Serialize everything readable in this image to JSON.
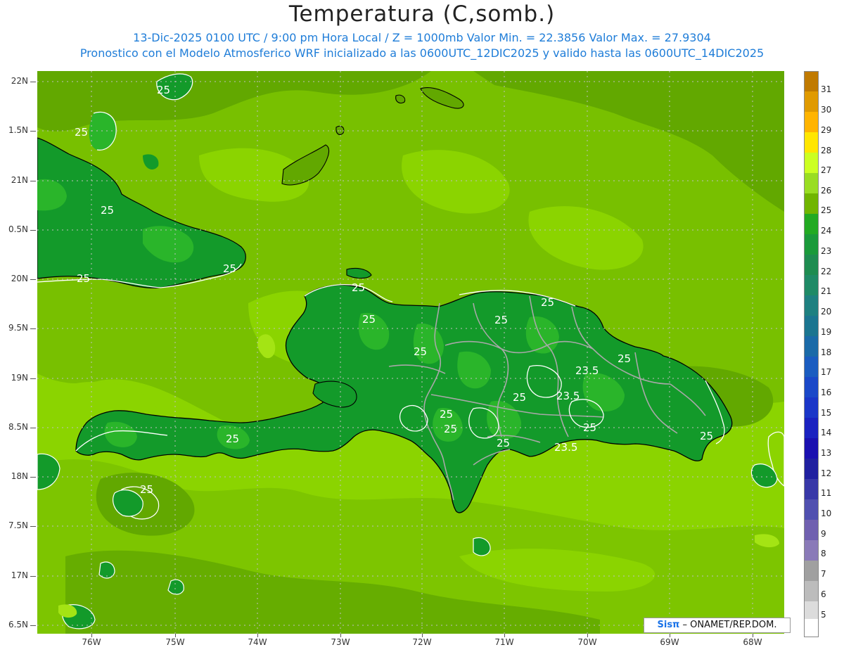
{
  "title": "Temperatura (C,somb.)",
  "subtitle_line1": "13-Dic-2025  0100 UTC / 9:00 pm Hora Local / Z = 1000mb   Valor Min. = 22.3856  Valor Max. = 27.9304",
  "subtitle_line2": "Pronostico con el Modelo Atmosferico WRF inicializado a las 0600UTC_12DIC2025 y valido hasta las  0600UTC_14DIC2025",
  "lat_labels": [
    "22N",
    "1.5N",
    "21N",
    "0.5N",
    "20N",
    "9.5N",
    "19N",
    "8.5N",
    "18N",
    "7.5N",
    "17N",
    "6.5N"
  ],
  "lon_labels": [
    "76W",
    "75W",
    "74W",
    "73W",
    "72W",
    "71W",
    "70W",
    "69W",
    "68W"
  ],
  "colorbar": {
    "labels": [
      "31",
      "30",
      "29",
      "28",
      "27",
      "26",
      "25",
      "24",
      "23",
      "22",
      "21",
      "20",
      "19",
      "18",
      "17",
      "16",
      "15",
      "14",
      "13",
      "12",
      "11",
      "10",
      "9",
      "8",
      "7",
      "6",
      "5"
    ],
    "colors": [
      "#c07a00",
      "#e09a00",
      "#ffb400",
      "#ffe600",
      "#ccff22",
      "#99dd22",
      "#70b500",
      "#22aa22",
      "#1a9a3a",
      "#1e8c50",
      "#1f8a66",
      "#1e8080",
      "#1b7590",
      "#1a6aa8",
      "#1a5cc0",
      "#1a48c8",
      "#1a36c8",
      "#1a22c0",
      "#1a10b0",
      "#2020a0",
      "#3838a8",
      "#5050b0",
      "#7060b0",
      "#8a7ab8",
      "#a0a0a0",
      "#bcbcbc",
      "#dcdcdc",
      "#ffffff"
    ]
  },
  "map": {
    "background_color": "#8bd400",
    "sea_mid_color": "#78c000",
    "sea_dark_color": "#62a800",
    "land_color": "#139a2a",
    "land_light_color": "#2ab52a",
    "contour_labels": [
      "25",
      "25",
      "25",
      "25",
      "25",
      "25",
      "25",
      "25",
      "25",
      "25",
      "25",
      "25",
      "25",
      "25",
      "25",
      "25",
      "25",
      "23.5",
      "23.5",
      "23.5"
    ]
  },
  "credit": {
    "brand": "Sisπ",
    "text": " – ONAMET/REP.DOM."
  }
}
